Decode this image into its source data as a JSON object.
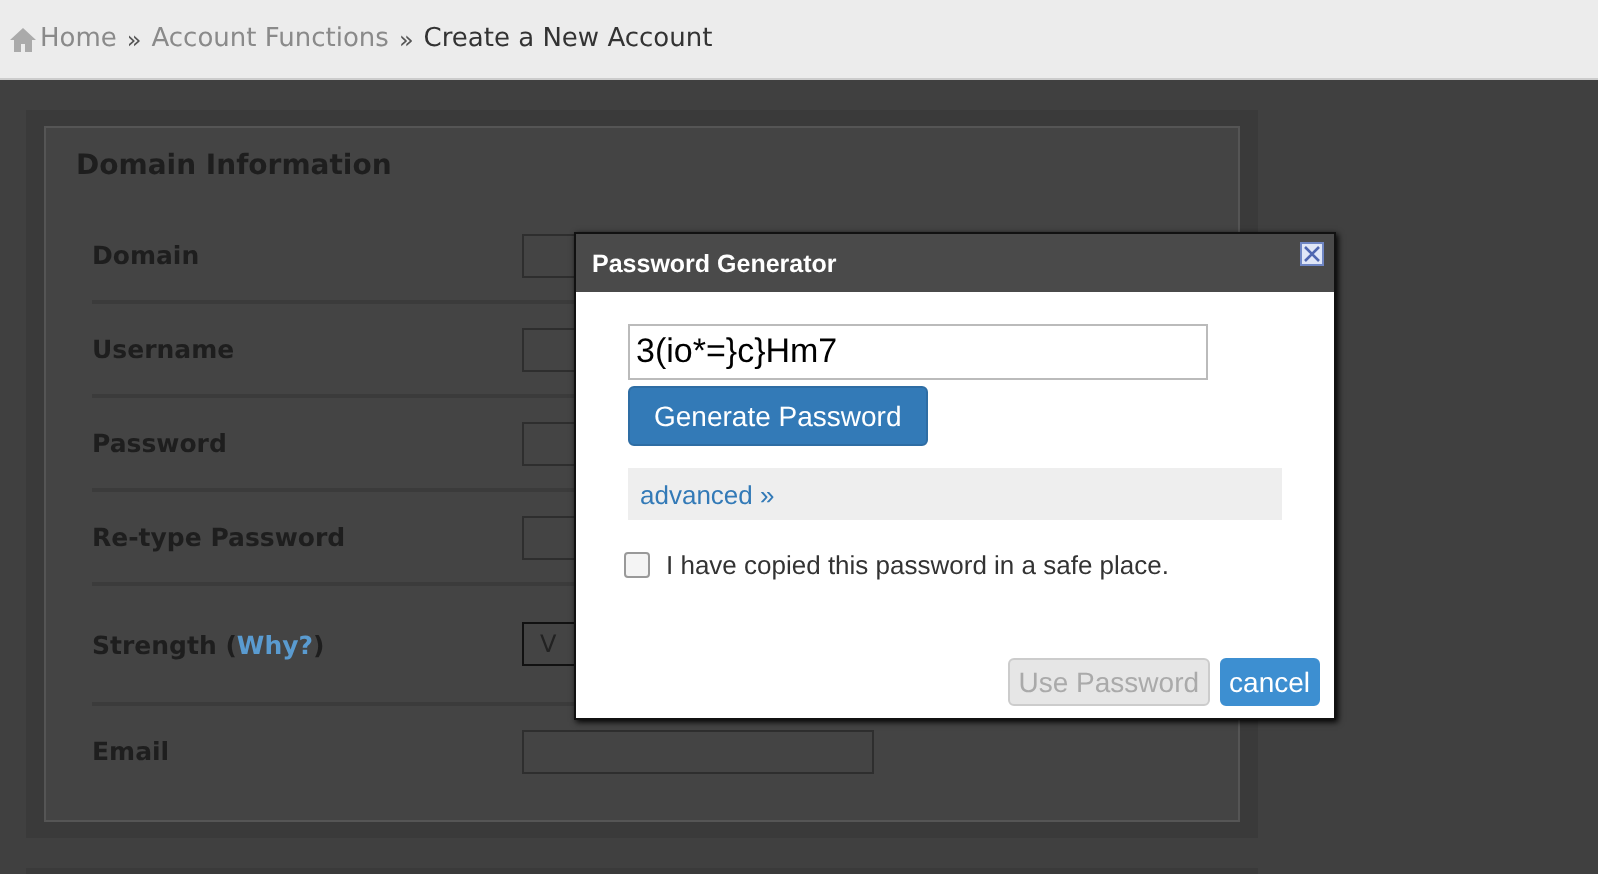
{
  "breadcrumb": [
    {
      "label": "Home",
      "kind": "home"
    },
    {
      "label": "Account Functions",
      "kind": "link"
    },
    {
      "label": "Create a New Account",
      "kind": "current"
    }
  ],
  "breadcrumb_separator": "»",
  "panel": {
    "title": "Domain Information",
    "fields": [
      {
        "label": "Domain",
        "kind": "input"
      },
      {
        "label": "Username",
        "kind": "input"
      },
      {
        "label": "Password",
        "kind": "input"
      },
      {
        "label": "Re-type Password",
        "kind": "input"
      },
      {
        "label": "Strength",
        "link_open": "(",
        "link": "Why?",
        "link_close": ")",
        "kind": "meter",
        "value": "V"
      },
      {
        "label": "Email",
        "kind": "input"
      }
    ]
  },
  "dialog": {
    "title": "Password Generator",
    "password": "3(io*=}c}Hm7",
    "generate_button": "Generate Password",
    "advanced_link": "advanced »",
    "confirm": {
      "label": "I have copied this password in a safe place.",
      "checked": false
    },
    "buttons": [
      {
        "label": "Use Password",
        "kind": "secondary",
        "disabled": true
      },
      {
        "label": "cancel",
        "kind": "primary",
        "disabled": false
      }
    ]
  }
}
